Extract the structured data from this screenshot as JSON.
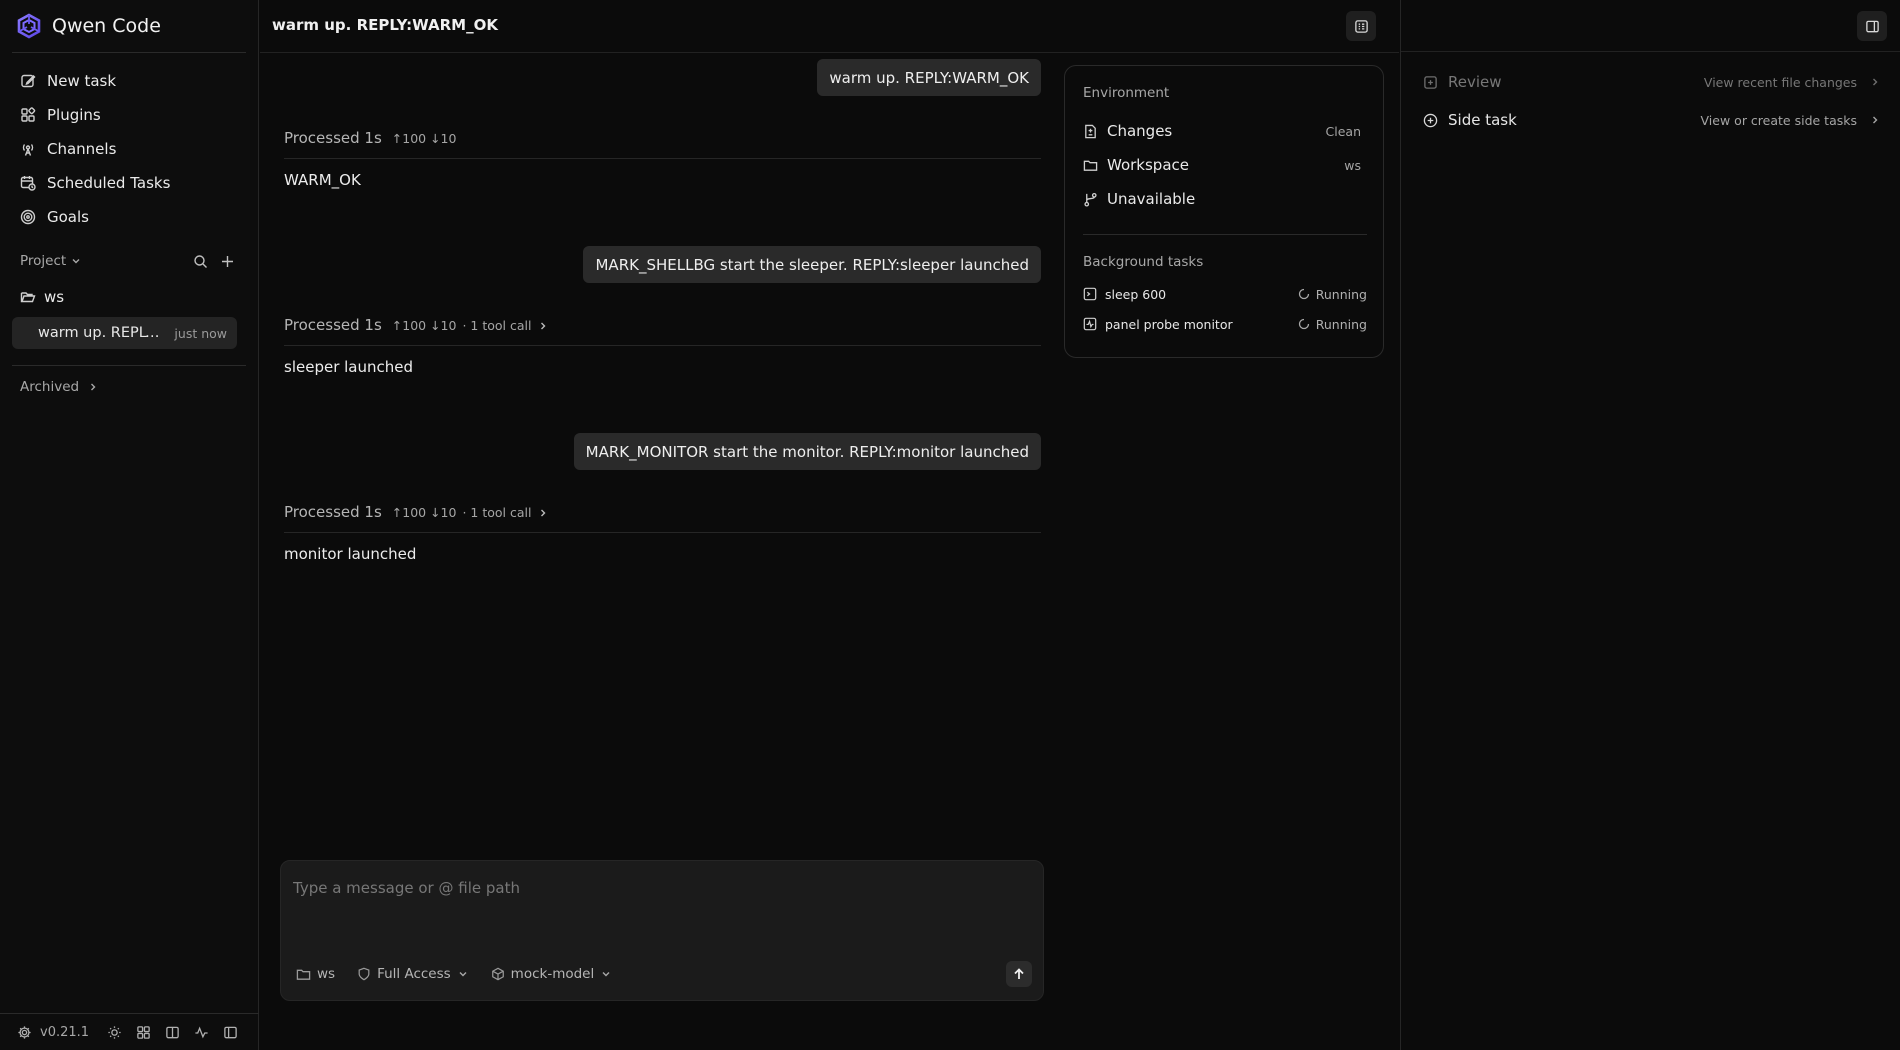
{
  "app": {
    "name": "Qwen Code",
    "version": "v0.21.1"
  },
  "sidebar": {
    "nav": [
      {
        "label": "New task",
        "icon": "edit-icon"
      },
      {
        "label": "Plugins",
        "icon": "plugins-icon"
      },
      {
        "label": "Channels",
        "icon": "antenna-icon"
      },
      {
        "label": "Scheduled Tasks",
        "icon": "calendar-clock-icon"
      },
      {
        "label": "Goals",
        "icon": "target-icon"
      }
    ],
    "project_label": "Project",
    "folder": "ws",
    "session": {
      "title": "warm up. REPLY:WARM_OK",
      "time": "just now"
    },
    "archived_label": "Archived"
  },
  "chat": {
    "title": "warm up. REPLY:WARM_OK",
    "messages": [
      {
        "user": "warm up. REPLY:WARM_OK",
        "processed": "Processed 1s",
        "meta": "↑100 ↓10",
        "tool": "",
        "reply": "WARM_OK"
      },
      {
        "user": "MARK_SHELLBG start the sleeper. REPLY:sleeper launched",
        "processed": "Processed 1s",
        "meta": "↑100 ↓10",
        "tool": "· 1 tool call",
        "reply": "sleeper launched"
      },
      {
        "user": "MARK_MONITOR start the monitor. REPLY:monitor launched",
        "processed": "Processed 1s",
        "meta": "↑100 ↓10",
        "tool": "· 1 tool call",
        "reply": "monitor launched"
      }
    ]
  },
  "composer": {
    "placeholder": "Type a message or @ file path",
    "folder": "ws",
    "access": "Full Access",
    "model": "mock-model"
  },
  "environment": {
    "heading": "Environment",
    "rows": [
      {
        "label": "Changes",
        "value": "Clean"
      },
      {
        "label": "Workspace",
        "value": "ws"
      },
      {
        "label": "Unavailable",
        "value": ""
      }
    ],
    "bg_heading": "Background tasks",
    "bg_tasks": [
      {
        "label": "sleep 600",
        "status": "Running"
      },
      {
        "label": "panel probe monitor",
        "status": "Running"
      }
    ]
  },
  "right_panel": {
    "rows": [
      {
        "label": "Review",
        "hint": "View recent file changes",
        "disabled": true
      },
      {
        "label": "Side task",
        "hint": "View or create side tasks",
        "disabled": false
      }
    ]
  }
}
